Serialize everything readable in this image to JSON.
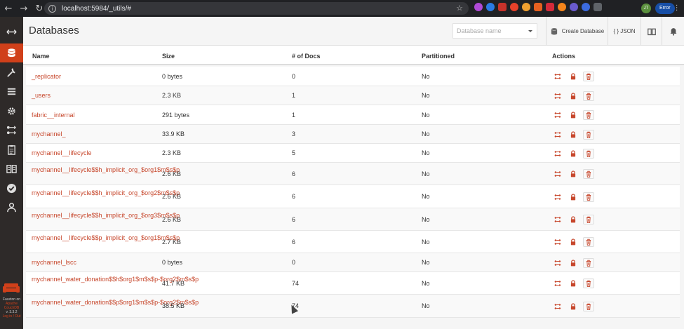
{
  "browser": {
    "url": "localhost:5984/_utils/#",
    "profile_initials": "JT",
    "error_chip": "Error",
    "nav": {
      "back": "←",
      "forward": "→",
      "reload": "↻"
    },
    "icons": [
      "back-icon",
      "forward-icon",
      "reload-icon",
      "star-icon",
      "extension-icons"
    ]
  },
  "sidebar": {
    "items": [
      {
        "name": "toggle-menu-icon"
      },
      {
        "name": "databases-icon",
        "active": true
      },
      {
        "name": "setup-wrench-icon"
      },
      {
        "name": "active-tasks-icon"
      },
      {
        "name": "config-gear-icon"
      },
      {
        "name": "replication-icon"
      },
      {
        "name": "clipboard-icon"
      },
      {
        "name": "documentation-book-icon"
      },
      {
        "name": "verify-check-icon"
      },
      {
        "name": "user-icon"
      }
    ],
    "footer_lines": [
      "Fauxton on",
      "Apache",
      "CouchDB",
      "v. 3.3.2",
      "Log in / Out"
    ]
  },
  "header": {
    "title": "Databases",
    "db_select_placeholder": "Database name",
    "create_label": "Create Database",
    "json_label": "{ } JSON"
  },
  "table": {
    "columns": [
      "Name",
      "Size",
      "# of Docs",
      "Partitioned",
      "Actions"
    ],
    "rows": [
      {
        "name": "_replicator",
        "size": "0 bytes",
        "docs": "0",
        "partitioned": "No"
      },
      {
        "name": "_users",
        "size": "2.3 KB",
        "docs": "1",
        "partitioned": "No"
      },
      {
        "name": "fabric__internal",
        "size": "291 bytes",
        "docs": "1",
        "partitioned": "No"
      },
      {
        "name": "mychannel_",
        "size": "33.9 KB",
        "docs": "3",
        "partitioned": "No"
      },
      {
        "name": "mychannel__lifecycle",
        "size": "2.3 KB",
        "docs": "5",
        "partitioned": "No"
      },
      {
        "name": "mychannel__lifecycle$$h_implicit_org_$org1$m$s$p",
        "size": "2.6 KB",
        "docs": "6",
        "partitioned": "No"
      },
      {
        "name": "mychannel__lifecycle$$h_implicit_org_$org2$m$s$p",
        "size": "2.6 KB",
        "docs": "6",
        "partitioned": "No"
      },
      {
        "name": "mychannel__lifecycle$$h_implicit_org_$org3$m$s$p",
        "size": "2.6 KB",
        "docs": "6",
        "partitioned": "No"
      },
      {
        "name": "mychannel__lifecycle$$p_implicit_org_$org1$m$s$p",
        "size": "2.7 KB",
        "docs": "6",
        "partitioned": "No"
      },
      {
        "name": "mychannel_lscc",
        "size": "0 bytes",
        "docs": "0",
        "partitioned": "No"
      },
      {
        "name": "mychannel_water_donation$$h$org1$m$s$p-$org2$m$s$p",
        "size": "41.7 KB",
        "docs": "74",
        "partitioned": "No"
      },
      {
        "name": "mychannel_water_donation$$p$org1$m$s$p-$org2$m$s$p",
        "size": "38.5 KB",
        "docs": "74",
        "partitioned": "No"
      }
    ]
  },
  "colors": {
    "accent": "#d0401a",
    "link": "#c7472c",
    "sidebar_bg": "#2e2a29"
  }
}
